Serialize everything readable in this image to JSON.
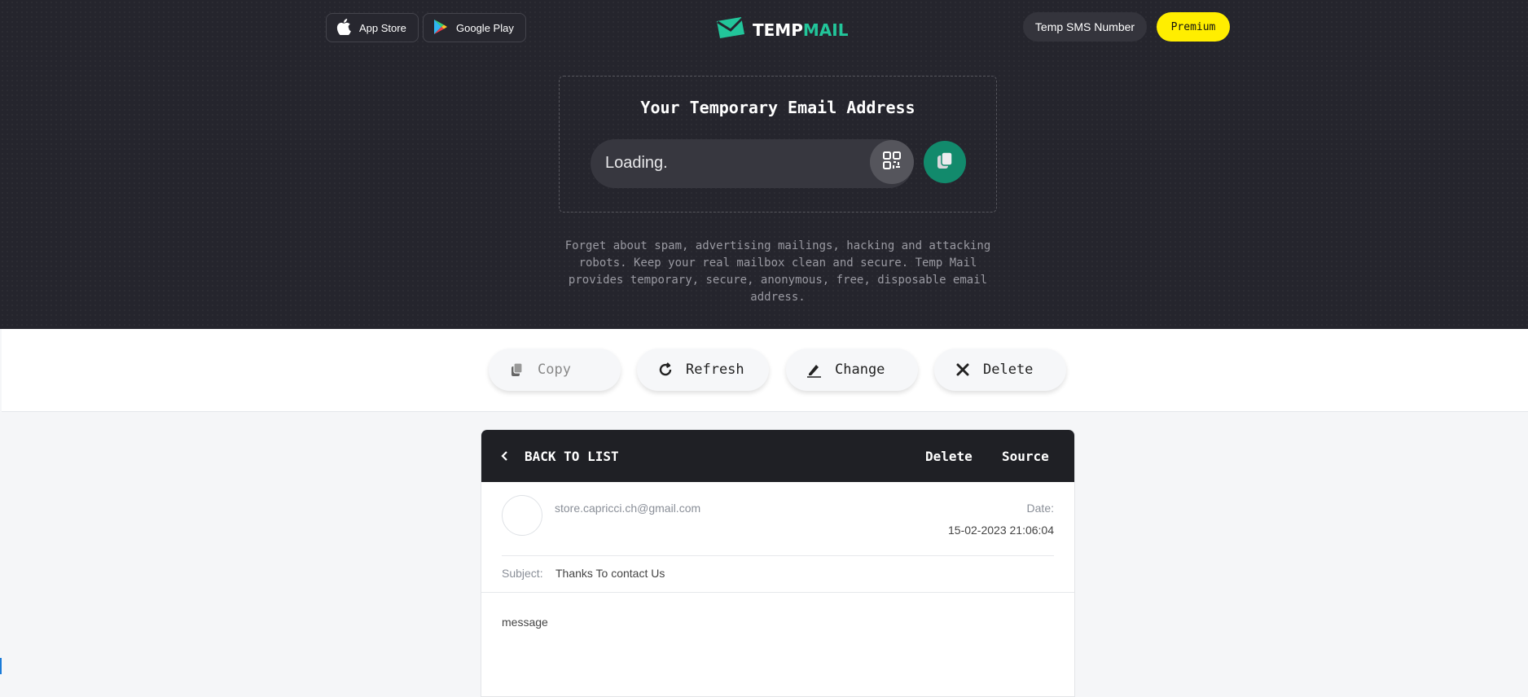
{
  "header": {
    "app_store_label": "App Store",
    "google_play_label": "Google Play",
    "logo_part1": "TEMP",
    "logo_part2": "MAIL",
    "sms_label": "Temp SMS Number",
    "premium_label": "Premium"
  },
  "address_box": {
    "title": "Your Temporary Email Address",
    "email_value": "Loading."
  },
  "description": "Forget about spam, advertising mailings, hacking and attacking robots. Keep your real mailbox clean and secure. Temp Mail provides temporary, secure, anonymous, free, disposable email address.",
  "actions": {
    "copy": "Copy",
    "refresh": "Refresh",
    "change": "Change",
    "delete": "Delete"
  },
  "message_view": {
    "back_label": "BACK TO LIST",
    "delete_label": "Delete",
    "source_label": "Source",
    "from": "store.capricci.ch@gmail.com",
    "date_label": "Date:",
    "date_value": "15-02-2023 21:06:04",
    "subject_label": "Subject:",
    "subject_value": "Thanks To contact Us",
    "body": "message"
  },
  "colors": {
    "accent_green": "#128a6c",
    "logo_green": "#22c59a",
    "premium_yellow": "#ffee00",
    "dark_bg": "#25252d"
  }
}
